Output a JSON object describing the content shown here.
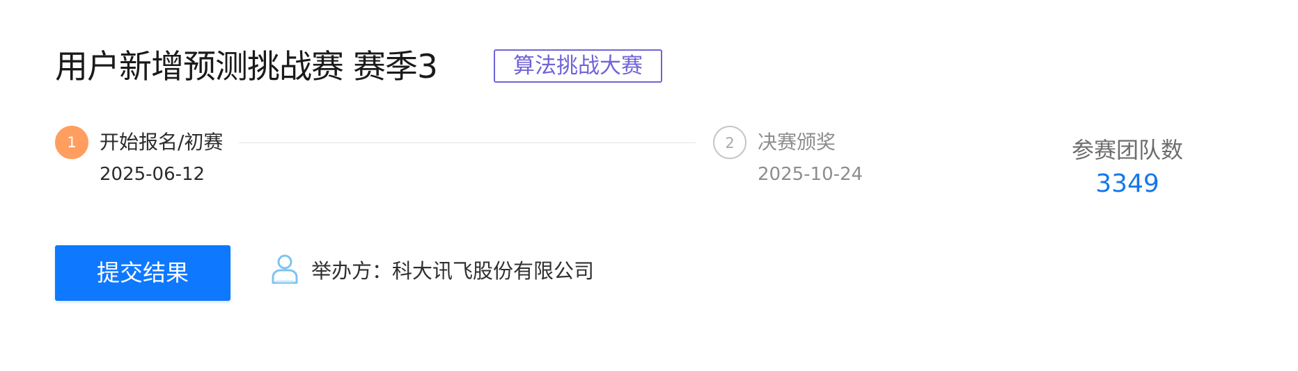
{
  "competition": {
    "title": "用户新增预测挑战赛 赛季3",
    "tag": "算法挑战大赛"
  },
  "steps": [
    {
      "number": "1",
      "title": "开始报名/初赛",
      "date": "2025-06-12",
      "status": "active"
    },
    {
      "number": "2",
      "title": "决赛颁奖",
      "date": "2025-10-24",
      "status": "pending"
    }
  ],
  "stats": {
    "team_label": "参赛团队数",
    "team_count": "3349"
  },
  "actions": {
    "submit_label": "提交结果"
  },
  "organizer": {
    "icon": "user-icon",
    "text": "举办方：科大讯飞股份有限公司"
  },
  "colors": {
    "accent_blue": "#0e78ff",
    "count_blue": "#1677e8",
    "tag_purple": "#6f63d8",
    "step_active": "#ff9e5e"
  }
}
